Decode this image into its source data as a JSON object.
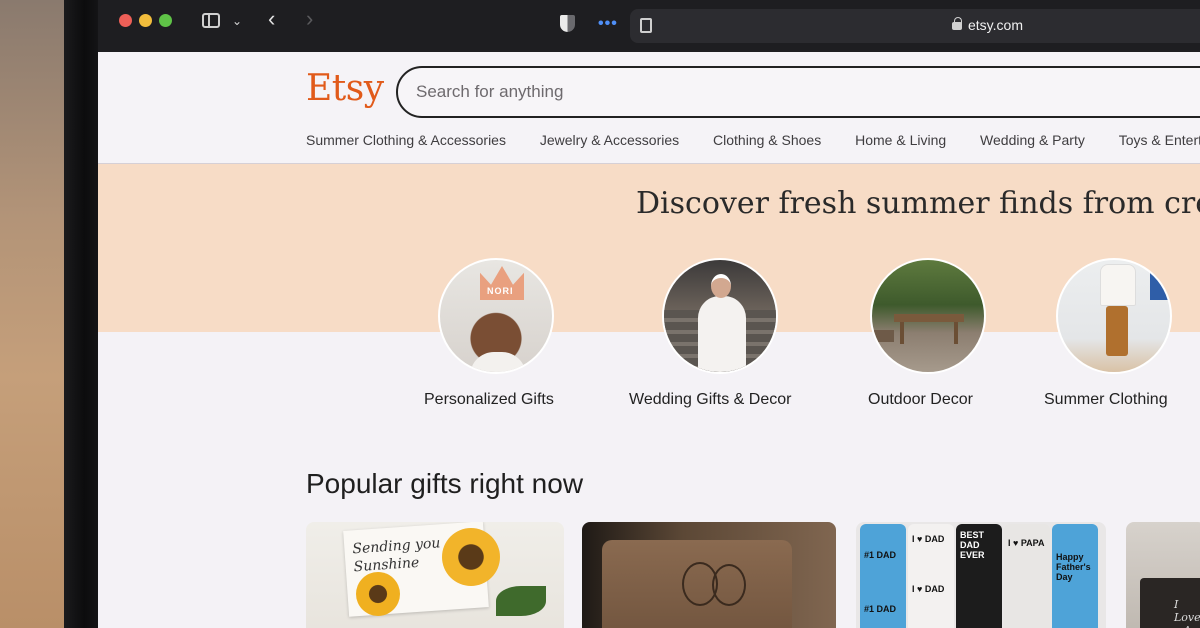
{
  "browser": {
    "url": "etsy.com"
  },
  "header": {
    "logo": "Etsy",
    "search_placeholder": "Search for anything",
    "categories": [
      "Summer Clothing & Accessories",
      "Jewelry & Accessories",
      "Clothing & Shoes",
      "Home & Living",
      "Wedding & Party",
      "Toys & Enterta"
    ]
  },
  "hero": {
    "title": "Discover fresh summer finds from creativ",
    "categories": [
      {
        "label": "Personalized Gifts",
        "badge": "NORI"
      },
      {
        "label": "Wedding Gifts & Decor"
      },
      {
        "label": "Outdoor Decor"
      },
      {
        "label": "Summer Clothing"
      }
    ]
  },
  "popular": {
    "title": "Popular gifts right now",
    "products": [
      {
        "name": "sunshine-gift-box",
        "text": "Sending you Sunshine"
      },
      {
        "name": "engraved-leather-wallet"
      },
      {
        "name": "custom-dad-socks",
        "badges": [
          "#1 DAD",
          "I ♥ DAD",
          "BEST DAD EVER",
          "I ♥ PAPA",
          "Happy Father's Day"
        ]
      },
      {
        "name": "personalized-bag",
        "text": "I Love ~Ar"
      }
    ]
  },
  "colors": {
    "brand": "#e15a1a",
    "hero_bg": "#f7dcc6",
    "page_bg": "#f4f2f6"
  }
}
